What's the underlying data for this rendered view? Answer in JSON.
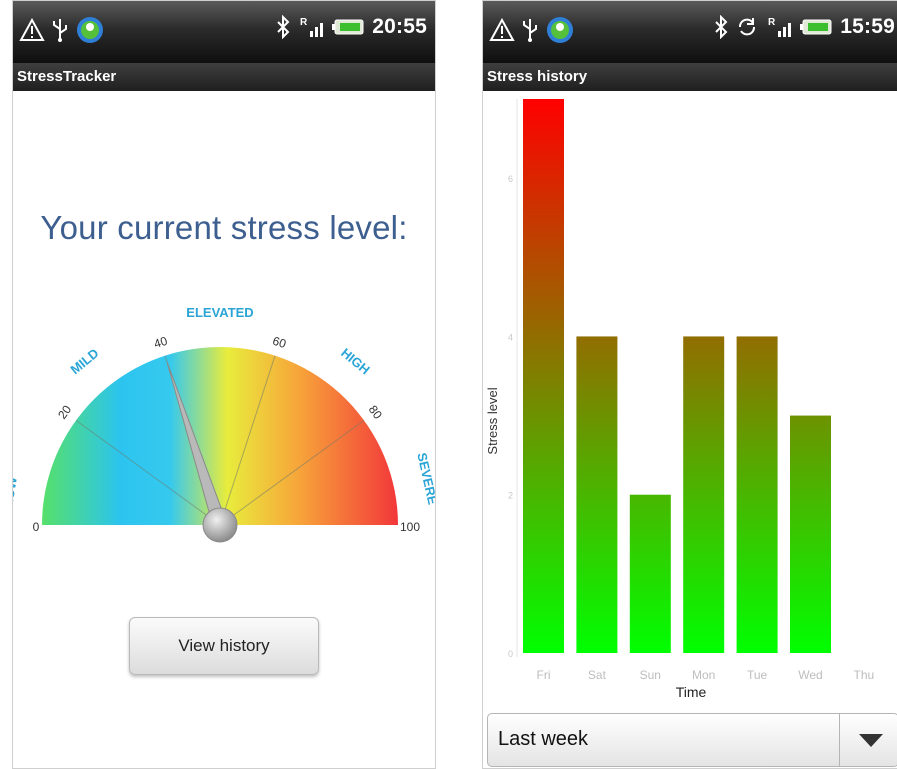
{
  "left_screen": {
    "status": {
      "time": "20:55"
    },
    "app_title": "StressTracker",
    "headline": "Your current stress level:",
    "gauge": {
      "value": 40,
      "min": 0,
      "max": 100,
      "ticks": [
        {
          "value": 0,
          "label": "0"
        },
        {
          "value": 20,
          "label": "20"
        },
        {
          "value": 40,
          "label": "40"
        },
        {
          "value": 60,
          "label": "60"
        },
        {
          "value": 80,
          "label": "80"
        },
        {
          "value": 100,
          "label": "100"
        }
      ],
      "zones": [
        {
          "label": "LOW",
          "center": 5
        },
        {
          "label": "MILD",
          "center": 28
        },
        {
          "label": "ELEVATED",
          "center": 50
        },
        {
          "label": "HIGH",
          "center": 72
        },
        {
          "label": "SEVERE",
          "center": 93
        }
      ],
      "zone_color": "#2aa5d6"
    },
    "button_label": "View history"
  },
  "right_screen": {
    "status": {
      "time": "15:59"
    },
    "app_title": "Stress history",
    "dropdown": {
      "selected": "Last week"
    },
    "chart_data": {
      "type": "bar",
      "categories": [
        "Fri",
        "Sat",
        "Sun",
        "Mon",
        "Tue",
        "Wed",
        "Thu"
      ],
      "values": [
        7,
        4,
        2,
        4,
        4,
        3,
        0
      ],
      "xlabel": "Time",
      "ylabel": "Stress level",
      "ylim": [
        0,
        7
      ],
      "color_top": "#ff0000",
      "color_bottom": "#00ff00"
    }
  }
}
